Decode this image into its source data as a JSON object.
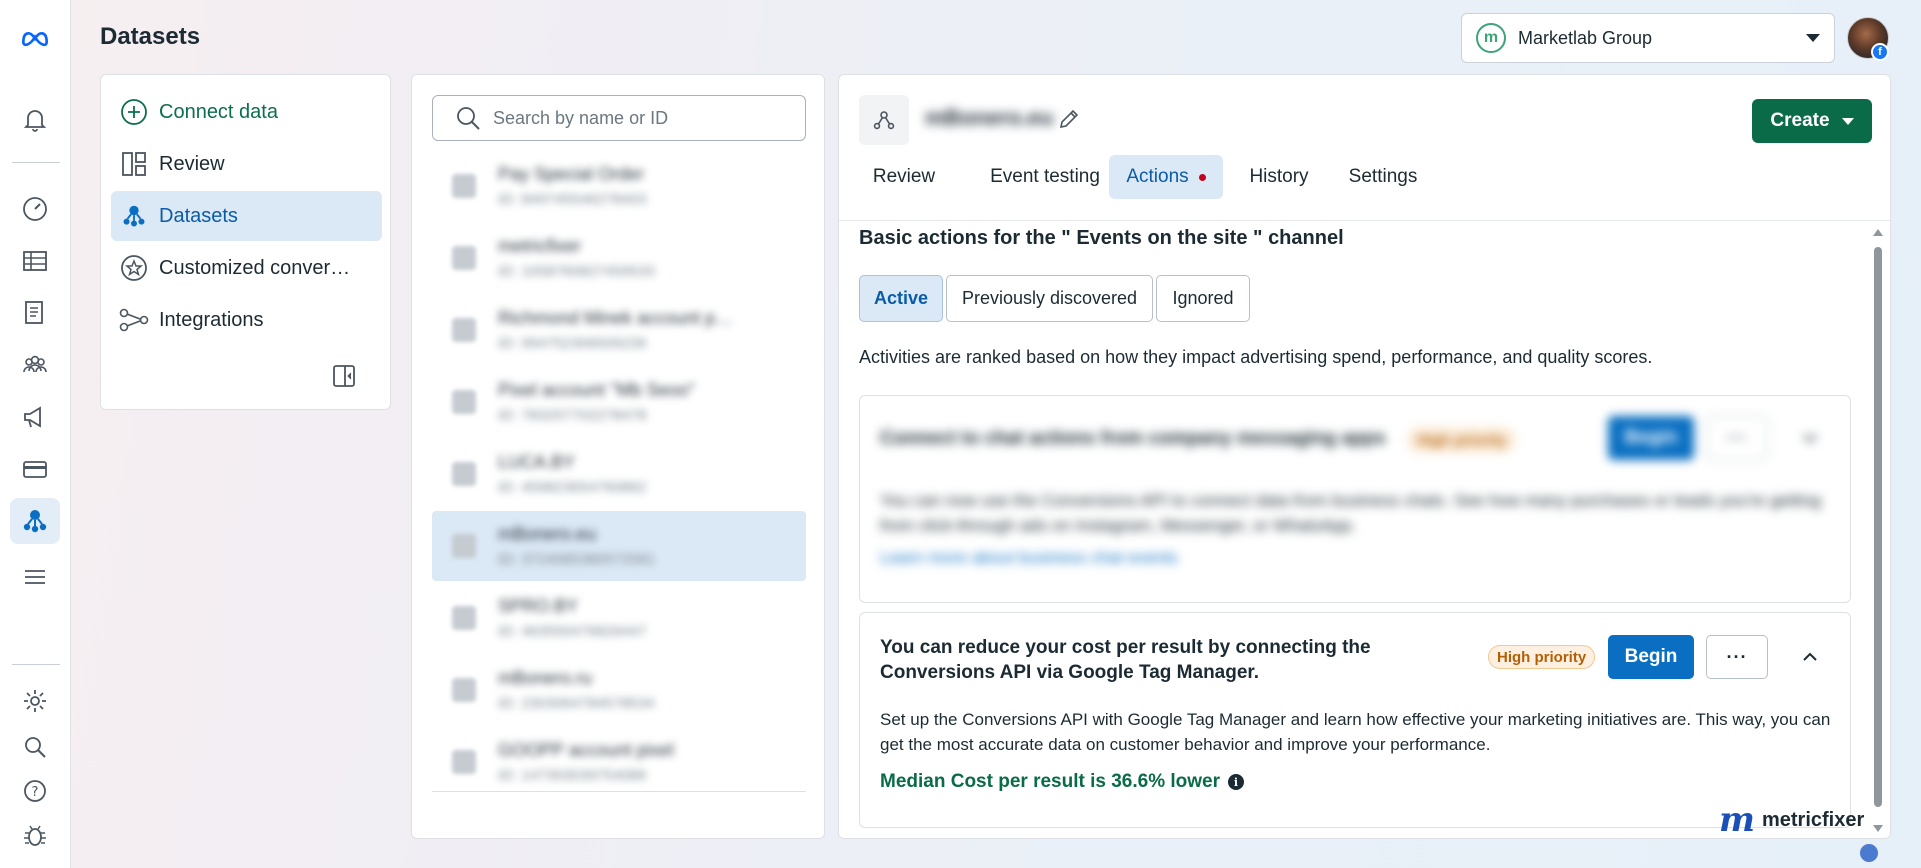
{
  "header": {
    "page_title": "Datasets",
    "business_name": "Marketlab Group",
    "business_logo_letter": "m"
  },
  "rail": {
    "icons": [
      "meta-logo-icon",
      "notifications-bell-icon",
      "dashboard-gauge-icon",
      "table-grid-icon",
      "pages-icon",
      "audiences-people-icon",
      "megaphone-icon",
      "billing-card-icon",
      "datasets-icon",
      "menu-icon",
      "settings-gear-icon",
      "search-icon",
      "help-icon",
      "bug-report-icon"
    ]
  },
  "nav": {
    "connect_data": "Connect data",
    "review": "Review",
    "datasets": "Datasets",
    "customized_conversions": "Customized conver…",
    "integrations": "Integrations"
  },
  "list": {
    "search_placeholder": "Search by name or ID",
    "items": [
      {
        "name": "Pay Special Order",
        "id": "ID: 849745546278403"
      },
      {
        "name": "metricfixer",
        "id": "ID: 1058760827459533"
      },
      {
        "name": "Richmond Minek account p…",
        "id": "ID: 994752306509239"
      },
      {
        "name": "Pixel account \"Mb Seoo\"",
        "id": "ID: 783257702278478"
      },
      {
        "name": "LUCA.BY",
        "id": "ID: 459823654760862"
      },
      {
        "name": "mBonero.eu",
        "id": "ID: 3724085380572581"
      },
      {
        "name": "SPRO.BY",
        "id": "ID: 463550476826447"
      },
      {
        "name": "mBonero.ru",
        "id": "ID: 2303064784578534"
      },
      {
        "name": "GOOPP account pixel",
        "id": "ID: 147303039754086"
      }
    ]
  },
  "main": {
    "dataset_title": "mBonero.eu",
    "create_label": "Create",
    "tabs": [
      "Review",
      "Event testing",
      "Actions",
      "History",
      "Settings"
    ],
    "section_title": "Basic actions for the \" Events on the site \" channel",
    "filters": [
      "Active",
      "Previously discovered",
      "Ignored"
    ],
    "description": "Activities are ranked based on how they impact advertising spend, performance, and quality scores.",
    "card1": {
      "title": "Connect to chat actions from company messaging apps",
      "priority": "High priority",
      "begin": "Begin",
      "more": "···",
      "body": "You can now use the Conversions API to connect data from business chats. See how many purchases or leads you're getting from click-through ads on Instagram, Messenger, or WhatsApp.",
      "link": "Learn more about business chat events"
    },
    "card2": {
      "title": "You can reduce your cost per result by connecting the Conversions API via Google Tag Manager.",
      "priority": "High priority",
      "begin": "Begin",
      "more": "···",
      "body": "Set up the Conversions API with Google Tag Manager and learn how effective your marketing initiatives are. This way, you can get the most accurate data on customer behavior and improve your performance.",
      "median": "Median Cost per result is 36.6% lower"
    }
  },
  "watermark": {
    "logo": "m",
    "text": "metricfixer"
  },
  "colors": {
    "primary_green": "#0a6b48",
    "accent_blue": "#0a6fc2",
    "selected_bg": "#dbe8f5"
  }
}
